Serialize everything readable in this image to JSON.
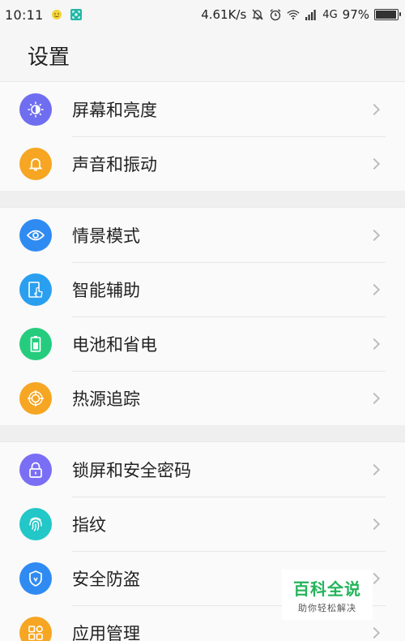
{
  "status_bar": {
    "time": "10:11",
    "net_speed": "4.61K/s",
    "network": "4G",
    "battery_percent": "97%",
    "battery_level": 0.97
  },
  "header": {
    "title": "设置"
  },
  "groups": [
    {
      "items": [
        {
          "label": "屏幕和亮度",
          "icon": "brightness-icon",
          "color": "#6f6ef0"
        },
        {
          "label": "声音和振动",
          "icon": "bell-icon",
          "color": "#f6a623"
        }
      ]
    },
    {
      "items": [
        {
          "label": "情景模式",
          "icon": "eye-icon",
          "color": "#2f8bf2"
        },
        {
          "label": "智能辅助",
          "icon": "phone-touch-icon",
          "color": "#2a9ff0"
        },
        {
          "label": "电池和省电",
          "icon": "battery-icon",
          "color": "#26cc7e"
        },
        {
          "label": "热源追踪",
          "icon": "target-icon",
          "color": "#f6a623"
        }
      ]
    },
    {
      "items": [
        {
          "label": "锁屏和安全密码",
          "icon": "lock-icon",
          "color": "#7a6ef5"
        },
        {
          "label": "指纹",
          "icon": "fingerprint-icon",
          "color": "#22c7c7"
        },
        {
          "label": "安全防盗",
          "icon": "shield-icon",
          "color": "#2f8bf2"
        },
        {
          "label": "应用管理",
          "icon": "apps-grid-icon",
          "color": "#f6a623"
        }
      ]
    }
  ],
  "watermark": {
    "title": "百科全说",
    "subtitle": "助你轻松解决"
  }
}
